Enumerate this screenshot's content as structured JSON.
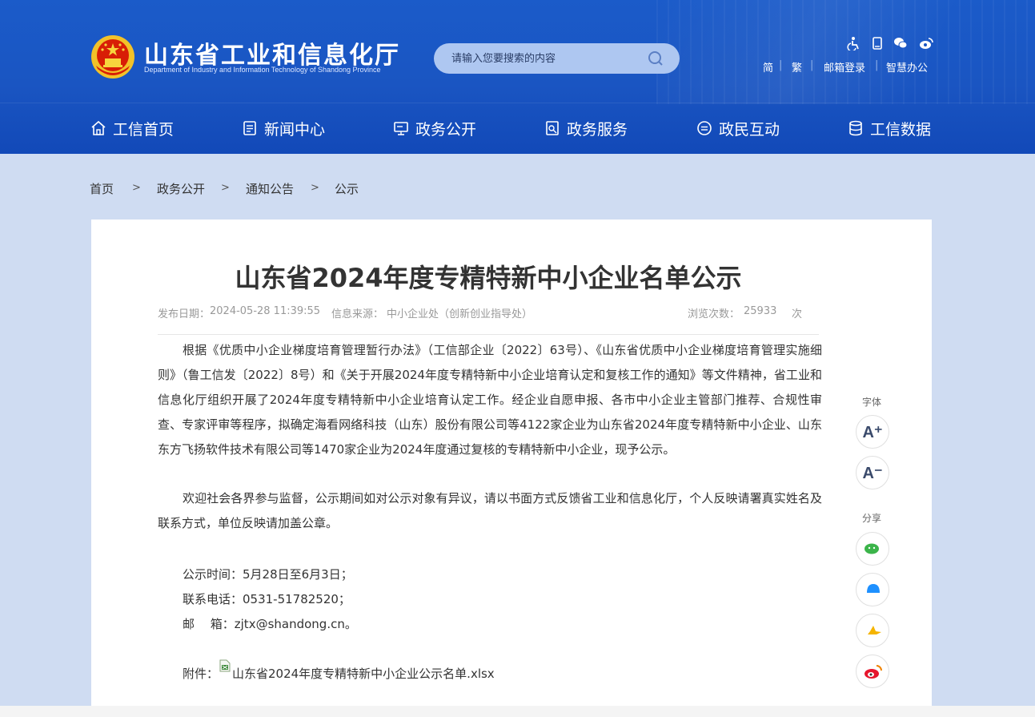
{
  "header": {
    "logo_cn": "山东省工业和信息化厅",
    "logo_en": "Department of Industry and Information Technology of Shandong Province",
    "search_placeholder": "请输入您要搜索的内容",
    "top_icons": [
      "accessibility-icon",
      "mobile-icon",
      "wechat-icon",
      "weibo-icon"
    ],
    "links": {
      "simplified": "简",
      "traditional": "繁",
      "mail_login": "邮箱登录",
      "smart_office": "智慧办公",
      "separator": "|"
    }
  },
  "nav": [
    {
      "label": "工信首页",
      "icon": "home-icon"
    },
    {
      "label": "新闻中心",
      "icon": "news-icon"
    },
    {
      "label": "政务公开",
      "icon": "monitor-icon"
    },
    {
      "label": "政务服务",
      "icon": "service-icon"
    },
    {
      "label": "政民互动",
      "icon": "chat-icon"
    },
    {
      "label": "工信数据",
      "icon": "database-icon"
    }
  ],
  "breadcrumb": {
    "items": [
      "首页",
      "政务公开",
      "通知公告",
      "公示"
    ],
    "separator": ">"
  },
  "article": {
    "title": "山东省2024年度专精特新中小企业名单公示",
    "meta": {
      "date_label": "发布日期：",
      "date": "2024-05-28 11:39:55",
      "source_label": "信息来源：",
      "source": "中小企业处（创新创业指导处）",
      "views_label": "浏览次数：",
      "views": "25933",
      "views_unit": "次"
    },
    "paragraphs": [
      "根据《优质中小企业梯度培育管理暂行办法》（工信部企业〔2022〕63号）、《山东省优质中小企业梯度培育管理实施细则》（鲁工信发〔2022〕8号）和《关于开展2024年度专精特新中小企业培育认定和复核工作的通知》等文件精神，省工业和信息化厅组织开展了2024年度专精特新中小企业培育认定工作。经企业自愿申报、各市中小企业主管部门推荐、合规性审查、专家评审等程序，拟确定海看网络科技（山东）股份有限公司等4122家企业为山东省2024年度专精特新中小企业、山东东方飞扬软件技术有限公司等1470家企业为2024年度通过复核的专精特新中小企业，现予公示。",
      "欢迎社会各界参与监督，公示期间如对公示对象有异议，请以书面方式反馈省工业和信息化厅，个人反映请署真实姓名及联系方式，单位反映请加盖公章。"
    ],
    "notice_period": "公示时间：5月28日至6月3日；",
    "phone": "联系电话：0531-51782520；",
    "email": "邮　 箱：zjtx@shandong.cn。",
    "attachment_label": "附件：",
    "attachment_name": "山东省2024年度专精特新中小企业公示名单.xlsx"
  },
  "tools": {
    "font_label": "字体",
    "font_increase": "A⁺",
    "font_decrease": "A⁻",
    "share_label": "分享",
    "share_icons": [
      "wechat-share-icon",
      "qq-share-icon",
      "qzone-share-icon",
      "weibo-share-icon"
    ]
  },
  "colors": {
    "header_blue": "#1a55c2",
    "page_bg": "#cfdcf2",
    "search_bg": "#aec7f1"
  }
}
